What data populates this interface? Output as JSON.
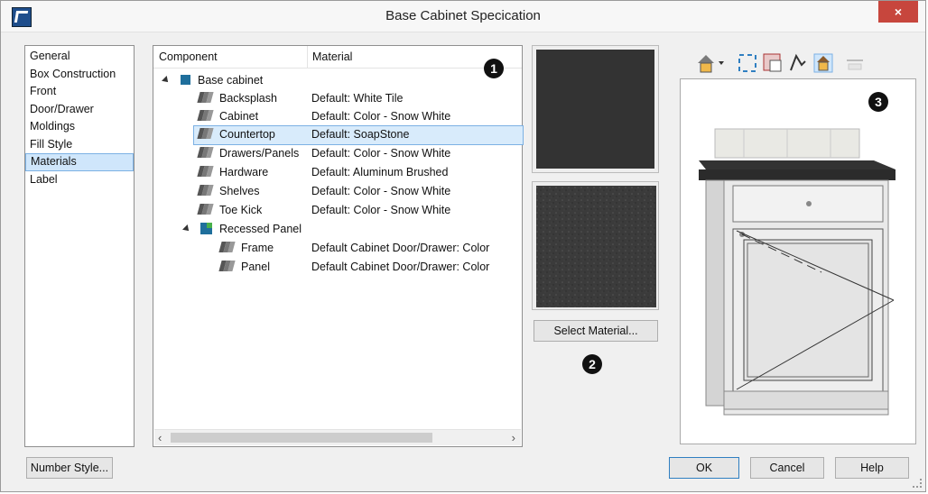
{
  "window": {
    "title": "Base Cabinet Specication",
    "close_label": "×"
  },
  "nav": {
    "items": [
      {
        "label": "General"
      },
      {
        "label": "Box Construction"
      },
      {
        "label": "Front"
      },
      {
        "label": "Door/Drawer"
      },
      {
        "label": "Moldings"
      },
      {
        "label": "Fill Style"
      },
      {
        "label": "Materials",
        "selected": true
      },
      {
        "label": "Label"
      }
    ]
  },
  "tree": {
    "columns": [
      "Component",
      "Material"
    ],
    "rows": [
      {
        "component": "Base cabinet",
        "material": "",
        "level": 0,
        "icon": "cabinet-icon"
      },
      {
        "component": "Backsplash",
        "material": "Default: White Tile",
        "level": 1,
        "icon": "material-icon"
      },
      {
        "component": "Cabinet",
        "material": "Default: Color - Snow White",
        "level": 1,
        "icon": "material-icon"
      },
      {
        "component": "Countertop",
        "material": "Default: SoapStone",
        "level": 1,
        "icon": "material-icon",
        "selected": true
      },
      {
        "component": "Drawers/Panels",
        "material": "Default: Color - Snow White",
        "level": 1,
        "icon": "material-icon"
      },
      {
        "component": "Hardware",
        "material": "Default: Aluminum Brushed",
        "level": 1,
        "icon": "material-icon"
      },
      {
        "component": "Shelves",
        "material": "Default: Color - Snow White",
        "level": 1,
        "icon": "material-icon"
      },
      {
        "component": "Toe Kick",
        "material": "Default: Color - Snow White",
        "level": 1,
        "icon": "material-icon"
      },
      {
        "component": "Recessed Panel",
        "material": "",
        "level": 1,
        "icon": "panel-icon"
      },
      {
        "component": "Frame",
        "material": "Default Cabinet Door/Drawer: Color",
        "level": 2,
        "icon": "material-icon"
      },
      {
        "component": "Panel",
        "material": "Default Cabinet Door/Drawer: Color",
        "level": 2,
        "icon": "material-icon"
      }
    ]
  },
  "buttons": {
    "select_material": "Select Material...",
    "number_style": "Number Style...",
    "ok": "OK",
    "cancel": "Cancel",
    "help": "Help"
  },
  "callouts": {
    "one": "1",
    "two": "2",
    "three": "3"
  },
  "toolbar": {
    "icons": [
      "camera-view-icon",
      "fit-window-icon",
      "layer-icon",
      "fill-pattern-icon",
      "colored-view-icon",
      "disabled-ruler-icon"
    ]
  },
  "colors": {
    "selection": "#d8ebfb",
    "selection_border": "#7cb1e4",
    "countertop": "#333333",
    "close": "#c7463d"
  }
}
